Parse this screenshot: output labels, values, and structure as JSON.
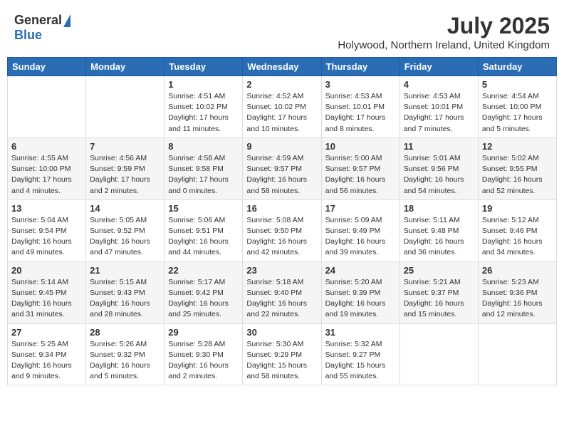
{
  "logo": {
    "general": "General",
    "blue": "Blue"
  },
  "title": "July 2025",
  "location": "Holywood, Northern Ireland, United Kingdom",
  "weekdays": [
    "Sunday",
    "Monday",
    "Tuesday",
    "Wednesday",
    "Thursday",
    "Friday",
    "Saturday"
  ],
  "weeks": [
    [
      null,
      null,
      {
        "day": 1,
        "sunrise": "4:51 AM",
        "sunset": "10:02 PM",
        "daylight": "17 hours and 11 minutes."
      },
      {
        "day": 2,
        "sunrise": "4:52 AM",
        "sunset": "10:02 PM",
        "daylight": "17 hours and 10 minutes."
      },
      {
        "day": 3,
        "sunrise": "4:53 AM",
        "sunset": "10:01 PM",
        "daylight": "17 hours and 8 minutes."
      },
      {
        "day": 4,
        "sunrise": "4:53 AM",
        "sunset": "10:01 PM",
        "daylight": "17 hours and 7 minutes."
      },
      {
        "day": 5,
        "sunrise": "4:54 AM",
        "sunset": "10:00 PM",
        "daylight": "17 hours and 5 minutes."
      }
    ],
    [
      {
        "day": 6,
        "sunrise": "4:55 AM",
        "sunset": "10:00 PM",
        "daylight": "17 hours and 4 minutes."
      },
      {
        "day": 7,
        "sunrise": "4:56 AM",
        "sunset": "9:59 PM",
        "daylight": "17 hours and 2 minutes."
      },
      {
        "day": 8,
        "sunrise": "4:58 AM",
        "sunset": "9:58 PM",
        "daylight": "17 hours and 0 minutes."
      },
      {
        "day": 9,
        "sunrise": "4:59 AM",
        "sunset": "9:57 PM",
        "daylight": "16 hours and 58 minutes."
      },
      {
        "day": 10,
        "sunrise": "5:00 AM",
        "sunset": "9:57 PM",
        "daylight": "16 hours and 56 minutes."
      },
      {
        "day": 11,
        "sunrise": "5:01 AM",
        "sunset": "9:56 PM",
        "daylight": "16 hours and 54 minutes."
      },
      {
        "day": 12,
        "sunrise": "5:02 AM",
        "sunset": "9:55 PM",
        "daylight": "16 hours and 52 minutes."
      }
    ],
    [
      {
        "day": 13,
        "sunrise": "5:04 AM",
        "sunset": "9:54 PM",
        "daylight": "16 hours and 49 minutes."
      },
      {
        "day": 14,
        "sunrise": "5:05 AM",
        "sunset": "9:52 PM",
        "daylight": "16 hours and 47 minutes."
      },
      {
        "day": 15,
        "sunrise": "5:06 AM",
        "sunset": "9:51 PM",
        "daylight": "16 hours and 44 minutes."
      },
      {
        "day": 16,
        "sunrise": "5:08 AM",
        "sunset": "9:50 PM",
        "daylight": "16 hours and 42 minutes."
      },
      {
        "day": 17,
        "sunrise": "5:09 AM",
        "sunset": "9:49 PM",
        "daylight": "16 hours and 39 minutes."
      },
      {
        "day": 18,
        "sunrise": "5:11 AM",
        "sunset": "9:48 PM",
        "daylight": "16 hours and 36 minutes."
      },
      {
        "day": 19,
        "sunrise": "5:12 AM",
        "sunset": "9:46 PM",
        "daylight": "16 hours and 34 minutes."
      }
    ],
    [
      {
        "day": 20,
        "sunrise": "5:14 AM",
        "sunset": "9:45 PM",
        "daylight": "16 hours and 31 minutes."
      },
      {
        "day": 21,
        "sunrise": "5:15 AM",
        "sunset": "9:43 PM",
        "daylight": "16 hours and 28 minutes."
      },
      {
        "day": 22,
        "sunrise": "5:17 AM",
        "sunset": "9:42 PM",
        "daylight": "16 hours and 25 minutes."
      },
      {
        "day": 23,
        "sunrise": "5:18 AM",
        "sunset": "9:40 PM",
        "daylight": "16 hours and 22 minutes."
      },
      {
        "day": 24,
        "sunrise": "5:20 AM",
        "sunset": "9:39 PM",
        "daylight": "16 hours and 19 minutes."
      },
      {
        "day": 25,
        "sunrise": "5:21 AM",
        "sunset": "9:37 PM",
        "daylight": "16 hours and 15 minutes."
      },
      {
        "day": 26,
        "sunrise": "5:23 AM",
        "sunset": "9:36 PM",
        "daylight": "16 hours and 12 minutes."
      }
    ],
    [
      {
        "day": 27,
        "sunrise": "5:25 AM",
        "sunset": "9:34 PM",
        "daylight": "16 hours and 9 minutes."
      },
      {
        "day": 28,
        "sunrise": "5:26 AM",
        "sunset": "9:32 PM",
        "daylight": "16 hours and 5 minutes."
      },
      {
        "day": 29,
        "sunrise": "5:28 AM",
        "sunset": "9:30 PM",
        "daylight": "16 hours and 2 minutes."
      },
      {
        "day": 30,
        "sunrise": "5:30 AM",
        "sunset": "9:29 PM",
        "daylight": "15 hours and 58 minutes."
      },
      {
        "day": 31,
        "sunrise": "5:32 AM",
        "sunset": "9:27 PM",
        "daylight": "15 hours and 55 minutes."
      },
      null,
      null
    ]
  ]
}
